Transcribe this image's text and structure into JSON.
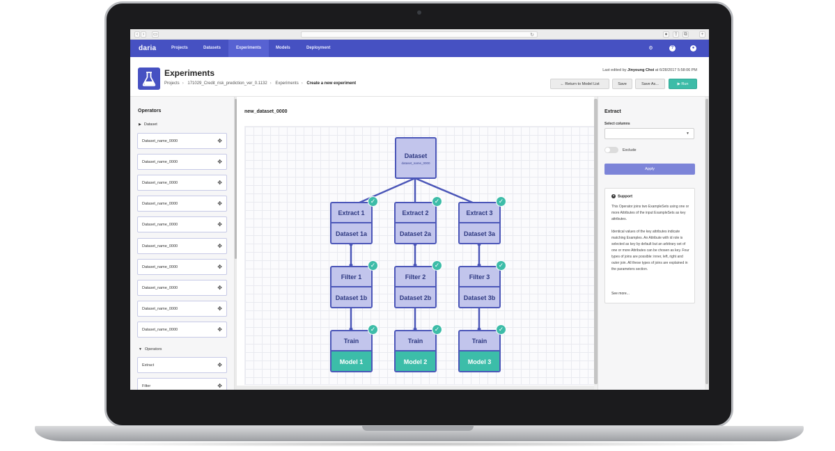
{
  "nav": {
    "logo": "daria",
    "items": [
      "Projects",
      "Datasets",
      "Experiments",
      "Models",
      "Deployment"
    ],
    "active": "Experiments",
    "icons": [
      "gear-icon",
      "help-icon",
      "user-icon"
    ]
  },
  "header": {
    "title": "Experiments",
    "breadcrumb": [
      "Projects",
      "171029_Credit_risk_prediction_ver_0.1132",
      "Experiments",
      "Create a new experiment"
    ],
    "edited_prefix": "Last edited by",
    "edited_user": "Jinyoung Choi",
    "edited_suffix": "at 6/28/2017 5:58:06 PM",
    "buttons": {
      "return": "Return to Model List",
      "save": "Save",
      "save_as": "Save As...",
      "run": "Run"
    }
  },
  "operators_panel": {
    "title": "Operators",
    "dataset_group": "Dataset",
    "dataset_items": [
      "Dataset_name_0000",
      "Dataset_name_0000",
      "Dataset_name_0000",
      "Dataset_name_0000",
      "Dataset_name_0000",
      "Dataset_name_0000",
      "Dataset_name_0000",
      "Dataset_name_0000",
      "Dataset_name_0000",
      "Dataset_name_0000"
    ],
    "operators_group": "Operators",
    "operator_items": [
      "Extract",
      "Filter"
    ]
  },
  "canvas": {
    "title": "new_dataset_0000",
    "root": {
      "label": "Dataset",
      "sub": "dataset_name_0000"
    },
    "columns": [
      {
        "extract": "Extract 1",
        "dataset_a": "Dataset 1a",
        "filter": "Filter 1",
        "dataset_b": "Dataset 1b",
        "train": "Train",
        "model": "Model 1"
      },
      {
        "extract": "Extract 2",
        "dataset_a": "Dataset 2a",
        "filter": "Filter 2",
        "dataset_b": "Dataset 2b",
        "train": "Train",
        "model": "Model 2"
      },
      {
        "extract": "Extract 3",
        "dataset_a": "Dataset 3a",
        "filter": "Filter 3",
        "dataset_b": "Dataset 3b",
        "train": "Train",
        "model": "Model 3"
      }
    ],
    "colors": {
      "node_fill": "#c2c5ec",
      "node_border": "#4b56b8",
      "model_fill": "#3cbda9",
      "check": "#3dbca8"
    }
  },
  "properties_panel": {
    "title": "Extract",
    "select_label": "Select columns",
    "select_value": "",
    "toggle_label": "Exclude",
    "toggle_on": false,
    "apply_label": "Apply",
    "support": {
      "title": "Support",
      "paragraph1": "This Operator joins two ExampleSets using one or more Attributes of the input ExampleSets as key attributes.",
      "paragraph2": "Identical values of the key attributes indicate matching Examples. An Attribute with id role is selected as key by default but an arbitrary set of one or more Attributes can be chosen as key. Four types of joins are possible: inner, left, right and outer join. All these types of joins are explained in the parameters section.",
      "see_more": "See more..."
    }
  }
}
